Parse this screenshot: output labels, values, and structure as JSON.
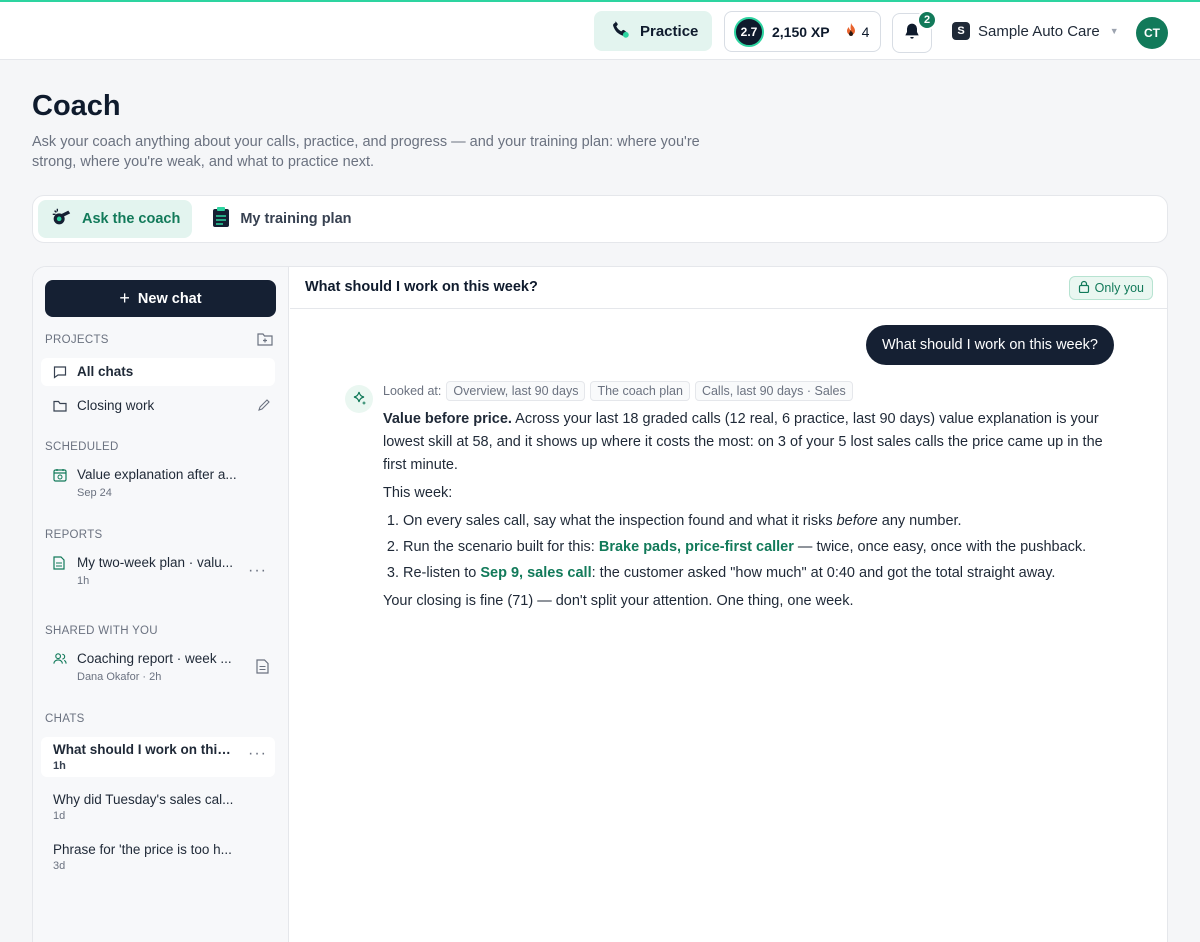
{
  "topbar": {
    "practice_label": "Practice",
    "level": "2.7",
    "xp": "2,150 XP",
    "streak": "4",
    "notifications": "2",
    "org_initial": "S",
    "org_name": "Sample Auto Care",
    "avatar_initials": "CT"
  },
  "header": {
    "title": "Coach",
    "subtitle": "Ask your coach anything about your calls, practice, and progress — and your training plan: where you're strong, where you're weak, and what to practice next."
  },
  "tabs": [
    {
      "label": "Ask the coach",
      "active": true
    },
    {
      "label": "My training plan",
      "active": false
    }
  ],
  "sidebar": {
    "new_chat_label": "New chat",
    "projects_label": "PROJECTS",
    "projects": [
      {
        "label": "All chats"
      },
      {
        "label": "Closing work"
      }
    ],
    "scheduled_label": "SCHEDULED",
    "scheduled": [
      {
        "label": "Value explanation after a...",
        "meta": "Sep 24"
      }
    ],
    "reports_label": "REPORTS",
    "reports": [
      {
        "label": "My two-week plan · valu...",
        "meta": "1h"
      }
    ],
    "shared_label": "SHARED WITH YOU",
    "shared": [
      {
        "label": "Coaching report · week ...",
        "meta": "Dana Okafor · 2h"
      }
    ],
    "chats_label": "CHATS",
    "chats": [
      {
        "label": "What should I work on this ...",
        "meta": "1h",
        "active": true
      },
      {
        "label": "Why did Tuesday's sales cal...",
        "meta": "1d"
      },
      {
        "label": "Phrase for 'the price is too h...",
        "meta": "3d"
      }
    ]
  },
  "main": {
    "title": "What should I work on this week?",
    "privacy_label": "Only you",
    "user_message": "What should I work on this week?",
    "looked_at_label": "Looked at:",
    "chips": [
      "Overview, last 90 days",
      "The coach plan",
      "Calls, last 90 days · Sales"
    ],
    "answer": {
      "lead_bold": "Value before price.",
      "lead_text": " Across your last 18 graded calls (12 real, 6 practice, last 90 days) value explanation is your lowest skill at 58, and it shows up where it costs the most: on 3 of your 5 lost sales calls the price came up in the first minute.",
      "this_week": "This week:",
      "item1_a": "On every sales call, say what the inspection found and what it risks ",
      "item1_em": "before",
      "item1_b": " any number.",
      "item2_a": "Run the scenario built for this: ",
      "item2_link": "Brake pads, price-first caller",
      "item2_b": " — twice, once easy, once with the pushback.",
      "item3_a": "Re-listen to ",
      "item3_link": "Sep 9, sales call",
      "item3_b": ": the customer asked \"how much\" at 0:40 and got the total straight away.",
      "closing": "Your closing is fine (71) — don't split your attention. One thing, one week."
    }
  },
  "colors": {
    "accent": "#127a5a",
    "dark": "#152033",
    "accent_bg": "#e3f4ef"
  }
}
